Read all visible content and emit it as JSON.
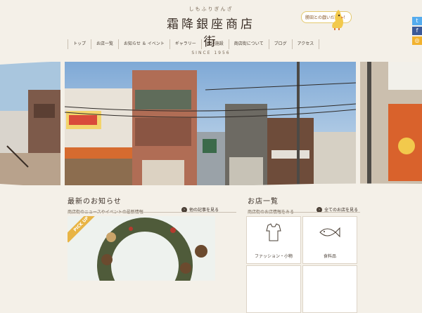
{
  "header": {
    "logo_kana": "しもふりぎんざ",
    "logo_title": "霜降銀座商店街",
    "logo_since": "SINCE 1956",
    "speech": "勝田との戯いだゼ〜！"
  },
  "nav": {
    "items": [
      "トップ",
      "お店一覧",
      "お知らせ ＆ イベント",
      "ギャラリー",
      "周辺施設",
      "商店街について",
      "ブログ",
      "アクセス"
    ]
  },
  "social": [
    "twitter-icon",
    "facebook-icon",
    "instagram-icon"
  ],
  "news": {
    "title": "最新のお知らせ",
    "subtitle": "商店街のニュースやイベントの最新情報",
    "more": "他の記事を見る",
    "pickup": "PICK UP"
  },
  "shops": {
    "title": "お店一覧",
    "subtitle": "商店街のお店情報をみる",
    "more": "全てのお店を見る",
    "tiles": [
      {
        "label": "ファッション・小物"
      },
      {
        "label": "食料品"
      },
      {
        "label": ""
      },
      {
        "label": ""
      }
    ]
  },
  "colors": {
    "background": "#f4f0e8",
    "accent": "#e8b445",
    "text": "#4a3f35"
  }
}
